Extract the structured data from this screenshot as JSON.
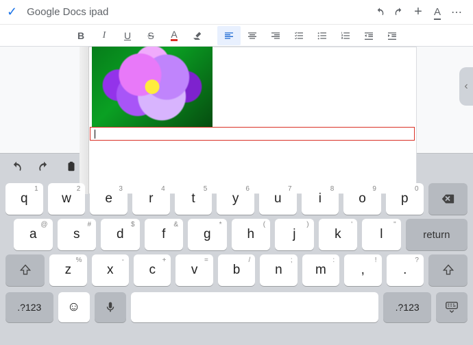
{
  "header": {
    "title": "Google Docs ipad"
  },
  "toolbar": {
    "bold": "B",
    "italic": "I",
    "underline": "U",
    "strike": "S",
    "textcolor": "A"
  },
  "keyboard": {
    "return": "return",
    "numtoggle": ".?123",
    "row1": [
      {
        "main": "q",
        "hint": "1"
      },
      {
        "main": "w",
        "hint": "2"
      },
      {
        "main": "e",
        "hint": "3"
      },
      {
        "main": "r",
        "hint": "4"
      },
      {
        "main": "t",
        "hint": "5"
      },
      {
        "main": "y",
        "hint": "6"
      },
      {
        "main": "u",
        "hint": "7"
      },
      {
        "main": "i",
        "hint": "8"
      },
      {
        "main": "o",
        "hint": "9"
      },
      {
        "main": "p",
        "hint": "0"
      }
    ],
    "row2": [
      {
        "main": "a",
        "hint": "@"
      },
      {
        "main": "s",
        "hint": "#"
      },
      {
        "main": "d",
        "hint": "$"
      },
      {
        "main": "f",
        "hint": "&"
      },
      {
        "main": "g",
        "hint": "*"
      },
      {
        "main": "h",
        "hint": "("
      },
      {
        "main": "j",
        "hint": ")"
      },
      {
        "main": "k",
        "hint": "'"
      },
      {
        "main": "l",
        "hint": "\""
      }
    ],
    "row3": [
      {
        "main": "z",
        "hint": "%"
      },
      {
        "main": "x",
        "hint": "-"
      },
      {
        "main": "c",
        "hint": "+"
      },
      {
        "main": "v",
        "hint": "="
      },
      {
        "main": "b",
        "hint": "/"
      },
      {
        "main": "n",
        "hint": ";"
      },
      {
        "main": "m",
        "hint": ":"
      },
      {
        "main": ",",
        "hint": "!"
      },
      {
        "main": ".",
        "hint": "?"
      }
    ]
  }
}
